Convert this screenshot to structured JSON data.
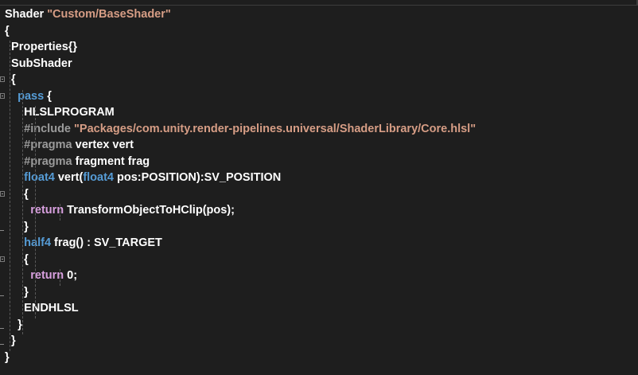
{
  "code_lines": [
    [
      {
        "t": "Shader ",
        "c": "white"
      },
      {
        "t": "\"Custom/BaseShader\"",
        "c": "str"
      }
    ],
    [
      {
        "t": "{",
        "c": "white"
      }
    ],
    [
      {
        "t": "  Properties{}",
        "c": "white"
      }
    ],
    [
      {
        "t": "  SubShader",
        "c": "white"
      }
    ],
    [
      {
        "t": "  {",
        "c": "white"
      }
    ],
    [
      {
        "t": "    ",
        "c": "white"
      },
      {
        "t": "pass",
        "c": "kw"
      },
      {
        "t": " {",
        "c": "white"
      }
    ],
    [
      {
        "t": "      HLSLPROGRAM",
        "c": "white"
      }
    ],
    [
      {
        "t": "      ",
        "c": "white"
      },
      {
        "t": "#include",
        "c": "pp"
      },
      {
        "t": " ",
        "c": "white"
      },
      {
        "t": "\"Packages/com.unity.render-pipelines.universal/ShaderLibrary/Core.hlsl\"",
        "c": "str"
      }
    ],
    [
      {
        "t": "      ",
        "c": "white"
      },
      {
        "t": "#pragma",
        "c": "pp"
      },
      {
        "t": " vertex vert",
        "c": "white"
      }
    ],
    [
      {
        "t": "      ",
        "c": "white"
      },
      {
        "t": "#pragma",
        "c": "pp"
      },
      {
        "t": " fragment frag",
        "c": "white"
      }
    ],
    [
      {
        "t": "      ",
        "c": "white"
      },
      {
        "t": "float4",
        "c": "kw"
      },
      {
        "t": " vert(",
        "c": "white"
      },
      {
        "t": "float4",
        "c": "kw"
      },
      {
        "t": " pos:POSITION):SV_POSITION",
        "c": "white"
      }
    ],
    [
      {
        "t": "      {",
        "c": "white"
      }
    ],
    [
      {
        "t": "        ",
        "c": "white"
      },
      {
        "t": "return",
        "c": "ctl"
      },
      {
        "t": " TransformObjectToHClip(pos);",
        "c": "white"
      }
    ],
    [
      {
        "t": "      }",
        "c": "white"
      }
    ],
    [
      {
        "t": "      ",
        "c": "white"
      },
      {
        "t": "half4",
        "c": "kw"
      },
      {
        "t": " frag() : SV_TARGET",
        "c": "white"
      }
    ],
    [
      {
        "t": "      {",
        "c": "white"
      }
    ],
    [
      {
        "t": "        ",
        "c": "white"
      },
      {
        "t": "return",
        "c": "ctl"
      },
      {
        "t": " 0;",
        "c": "white"
      }
    ],
    [
      {
        "t": "      }",
        "c": "white"
      }
    ],
    [
      {
        "t": "      ENDHLSL",
        "c": "white"
      }
    ],
    [
      {
        "t": "    }",
        "c": "white"
      }
    ],
    [
      {
        "t": "  }",
        "c": "white"
      }
    ],
    [
      {
        "t": "}",
        "c": "white"
      }
    ]
  ],
  "gutter": {
    "fold_open_lines": [
      4,
      5,
      11,
      15
    ],
    "fold_end_lines": [
      13,
      17,
      19,
      20
    ]
  },
  "colors": {
    "background": "#1e1e1e",
    "keyword": "#569cd6",
    "string": "#d69d85",
    "preprocessor": "#9b9b9b",
    "control": "#d8a0df",
    "text": "#ffffff"
  }
}
